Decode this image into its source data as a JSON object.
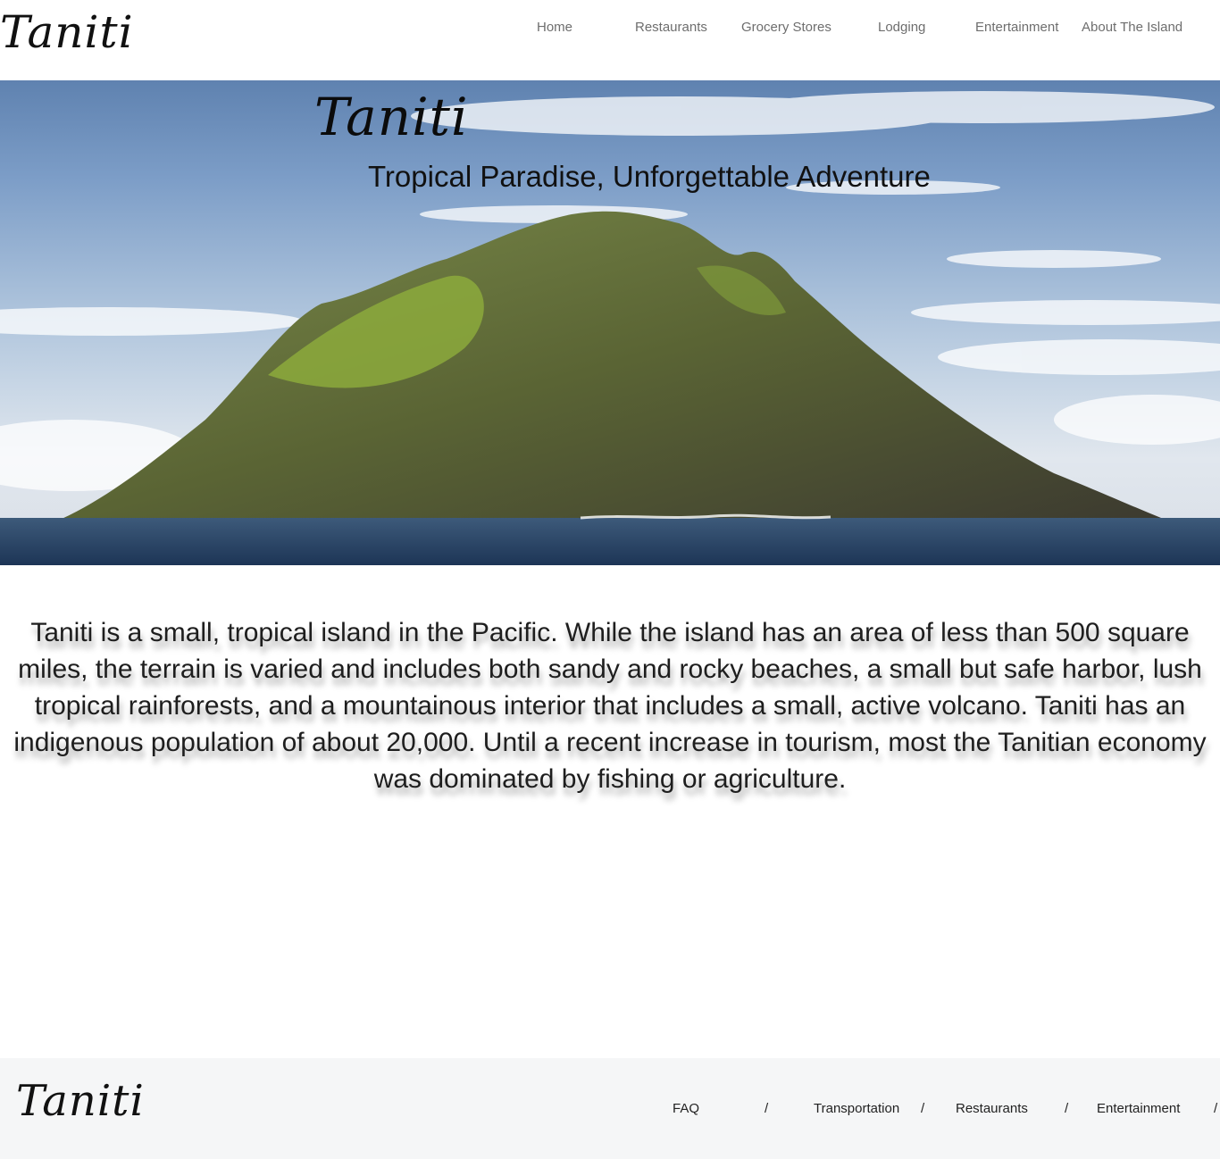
{
  "header": {
    "logo": "Taniti",
    "nav": [
      {
        "label": "Home"
      },
      {
        "label": "Restaurants"
      },
      {
        "label": "Grocery Stores"
      },
      {
        "label": "Lodging"
      },
      {
        "label": "Entertainment"
      },
      {
        "label": "About The Island"
      }
    ]
  },
  "hero": {
    "title": "Taniti",
    "tagline": "Tropical Paradise, Unforgettable Adventure"
  },
  "intro": {
    "text": "Taniti is a small, tropical island in the Pacific. While the island has an area of less than 500 square miles, the terrain is varied and includes both sandy and rocky beaches, a small but safe harbor, lush tropical rainforests, and a mountainous interior that includes a small, active volcano. Taniti has an indigenous population of about 20,000. Until a recent increase in tourism, most the Tanitian economy was dominated by fishing or agriculture."
  },
  "footer": {
    "logo": "Taniti",
    "links": [
      {
        "label": "FAQ"
      },
      {
        "label": "Transportation"
      },
      {
        "label": "Restaurants"
      },
      {
        "label": "Entertainment"
      }
    ],
    "separator": "/"
  }
}
